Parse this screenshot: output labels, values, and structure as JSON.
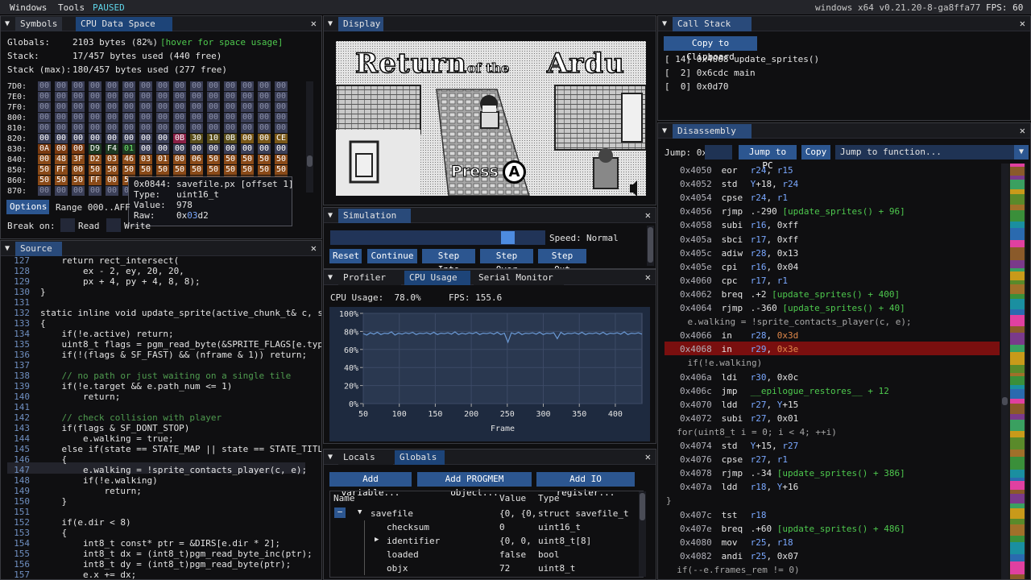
{
  "menubar": {
    "windows": "Windows",
    "tools": "Tools",
    "status": "PAUSED",
    "version": "windows x64 v0.21.20-8-ga8ffa77",
    "fps": "FPS: 60"
  },
  "symbols": {
    "tab1": "Symbols",
    "tab2": "CPU Data Space",
    "globals_label": "Globals:",
    "globals_value": "2103 bytes (82%)",
    "globals_hint": "[hover for space usage]",
    "stack_label": "Stack:",
    "stack_value": "17/457 bytes used (440 free)",
    "stackmax_label": "Stack (max):",
    "stackmax_value": "180/457 bytes used (277 free)",
    "hex_rows": [
      "7D0:",
      "7E0:",
      "7F0:",
      "800:",
      "810:",
      "820:",
      "830:",
      "840:",
      "850:",
      "860:",
      "870:"
    ],
    "row820": [
      "00",
      "00",
      "00",
      "00",
      "00",
      "00",
      "00",
      "00",
      "0B",
      "30",
      "10",
      "0B",
      "00",
      "00",
      "CE"
    ],
    "row830": [
      "0A",
      "00",
      "00",
      "D9",
      "F4",
      "01",
      "00",
      "00",
      "00",
      "00",
      "00",
      "00",
      "00",
      "00",
      "00"
    ],
    "row840": [
      "00",
      "48",
      "3F",
      "D2",
      "03",
      "46",
      "03",
      "01",
      "00",
      "06",
      "50",
      "50",
      "50",
      "50",
      "50"
    ],
    "row850": [
      "50",
      "FF",
      "00",
      "50",
      "50",
      "50",
      "50",
      "50",
      "50",
      "50",
      "50",
      "50",
      "50",
      "50",
      "50"
    ],
    "row860": [
      "50",
      "50",
      "50",
      "FF",
      "00",
      "50",
      "50",
      "50",
      "50",
      "50",
      "50",
      "50",
      "50",
      "50",
      "50"
    ],
    "tooltip": {
      "title": "0x0844: savefile.px [offset 1]",
      "type": "Type:   uint16_t",
      "value": "Value:  978",
      "raw_label": "Raw:    0x",
      "raw_a": "03",
      "raw_b": "d2"
    },
    "options": "Options",
    "range": "Range 000..AFF",
    "break_on": "Break on:",
    "read": "Read",
    "write": "Write"
  },
  "source": {
    "tab": "Source",
    "lines": [
      {
        "n": "127",
        "t": "    return rect_intersect("
      },
      {
        "n": "128",
        "t": "        ex - 2, ey, 20, 20,"
      },
      {
        "n": "129",
        "t": "        px + 4, py + 4, 8, 8);"
      },
      {
        "n": "130",
        "t": "}"
      },
      {
        "n": "131",
        "t": ""
      },
      {
        "n": "132",
        "t": "static inline void update_sprite(active_chunk_t& c, s"
      },
      {
        "n": "133",
        "t": "{"
      },
      {
        "n": "134",
        "t": "    if(!e.active) return;"
      },
      {
        "n": "135",
        "t": "    uint8_t flags = pgm_read_byte(&SPRITE_FLAGS[e.typ"
      },
      {
        "n": "136",
        "t": "    if(!(flags & SF_FAST) && (nframe & 1)) return;"
      },
      {
        "n": "137",
        "t": ""
      },
      {
        "n": "138",
        "t": "    // no path or just waiting on a single tile"
      },
      {
        "n": "139",
        "t": "    if(!e.target && e.path_num <= 1)"
      },
      {
        "n": "140",
        "t": "        return;"
      },
      {
        "n": "141",
        "t": ""
      },
      {
        "n": "142",
        "t": "    // check collision with player"
      },
      {
        "n": "143",
        "t": "    if(flags & SF_DONT_STOP)"
      },
      {
        "n": "144",
        "t": "        e.walking = true;"
      },
      {
        "n": "145",
        "t": "    else if(state == STATE_MAP || state == STATE_TITL"
      },
      {
        "n": "146",
        "t": "    {"
      },
      {
        "n": "147",
        "t": "        e.walking = !sprite_contacts_player(c, e);"
      },
      {
        "n": "148",
        "t": "        if(!e.walking)"
      },
      {
        "n": "149",
        "t": "            return;"
      },
      {
        "n": "150",
        "t": "    }"
      },
      {
        "n": "151",
        "t": ""
      },
      {
        "n": "152",
        "t": "    if(e.dir < 8)"
      },
      {
        "n": "153",
        "t": "    {"
      },
      {
        "n": "154",
        "t": "        int8_t const* ptr = &DIRS[e.dir * 2];"
      },
      {
        "n": "155",
        "t": "        int8_t dx = (int8_t)pgm_read_byte_inc(ptr);"
      },
      {
        "n": "156",
        "t": "        int8_t dy = (int8_t)pgm_read_byte(ptr);"
      },
      {
        "n": "157",
        "t": "        e.x += dx;"
      }
    ]
  },
  "display": {
    "tab": "Display",
    "title_a": "Return",
    "title_b": "of the",
    "title_c": "Ardu",
    "press": "Press",
    "btn_a": "A"
  },
  "simulation": {
    "tab": "Simulation",
    "speed_label": "Speed:",
    "speed_value": "Normal",
    "reset": "Reset",
    "continue": "Continue",
    "step_into": "Step Into",
    "step_over": "Step Over",
    "step_out": "Step Out"
  },
  "profiler": {
    "tab1": "Profiler",
    "tab2": "CPU Usage",
    "tab3": "Serial Monitor",
    "cpu_usage": "CPU Usage:  78.0%",
    "fps": "FPS: 155.6",
    "xlabel": "Frame"
  },
  "chart_data": {
    "type": "line",
    "xlabel": "Frame",
    "ylabel": "",
    "yticks": [
      "100%",
      "80%",
      "60%",
      "40%",
      "20%",
      "0%"
    ],
    "xticks": [
      "50",
      "100",
      "150",
      "200",
      "250",
      "300",
      "350",
      "400"
    ],
    "xlim": [
      50,
      437
    ],
    "ylim": [
      0,
      100
    ],
    "series": [
      {
        "values": [
          77.5,
          76.0,
          78.5,
          77.0,
          79.0,
          76.5,
          78.0,
          77.5,
          79.5,
          76.0,
          78.0,
          77.0,
          78.5,
          77.5,
          79.0,
          76.5,
          78.0,
          77.5,
          78.5,
          77.0,
          79.0,
          76.5,
          78.0,
          77.5,
          78.5,
          77.0,
          79.5,
          76.5,
          78.0,
          77.0,
          78.5,
          77.5,
          79.0,
          76.5,
          78.0,
          77.5,
          78.5,
          77.0,
          79.0,
          76.5,
          78.0,
          68.0,
          78.5,
          77.0,
          79.0,
          76.5,
          78.0,
          77.5,
          78.5,
          77.0,
          79.0,
          76.5,
          78.0,
          77.5,
          78.5,
          72.0,
          79.0,
          76.5,
          78.0,
          77.5,
          78.5,
          77.0,
          79.0,
          76.5,
          78.0,
          77.5,
          78.5,
          77.0,
          79.0,
          76.5,
          78.0,
          77.5,
          78.5,
          77.0,
          79.5,
          76.5,
          78.0,
          77.5,
          78.5,
          77.0
        ]
      }
    ]
  },
  "locals": {
    "tab1": "Locals",
    "tab2": "Globals",
    "add_var": "Add variable...",
    "add_progmem": "Add PROGMEM object...",
    "add_io": "Add IO register...",
    "col_name": "Name",
    "col_value": "Value",
    "col_type": "Type",
    "rows": [
      {
        "name": "savefile",
        "value": "{0, {0,",
        "type": "struct savefile_t"
      },
      {
        "name": "checksum",
        "value": "0",
        "type": "uint16_t"
      },
      {
        "name": "identifier",
        "value": "{0, 0,",
        "type": "uint8_t[8]"
      },
      {
        "name": "loaded",
        "value": "false",
        "type": "bool"
      },
      {
        "name": "objx",
        "value": "72",
        "type": "uint8_t"
      }
    ]
  },
  "callstack": {
    "tab": "Call Stack",
    "copy": "Copy to Clipboard",
    "frames": [
      {
        "idx": "[ 14]",
        "addr": "0x4068",
        "fn": "update_sprites()"
      },
      {
        "idx": "[  2]",
        "addr": "0x6cdc",
        "fn": "main"
      },
      {
        "idx": "[  0]",
        "addr": "0x0d70",
        "fn": ""
      }
    ]
  },
  "disasm": {
    "tab": "Disassembly",
    "jump_label": "Jump: 0x",
    "jump_pc": "Jump to PC",
    "copy": "Copy",
    "jump_fn": "Jump to function...",
    "lines": [
      {
        "k": "i",
        "a": "0x4050",
        "m": "eor",
        "o": [
          [
            "r24",
            "reg"
          ],
          [
            ", ",
            ""
          ],
          [
            "r15",
            "reg"
          ]
        ]
      },
      {
        "k": "i",
        "a": "0x4052",
        "m": "std",
        "o": [
          [
            "Y",
            "reg"
          ],
          [
            "+18, ",
            ""
          ],
          [
            "r24",
            "reg"
          ]
        ]
      },
      {
        "k": "i",
        "a": "0x4054",
        "m": "cpse",
        "o": [
          [
            "r24",
            "reg"
          ],
          [
            ", ",
            ""
          ],
          [
            "r1",
            "reg"
          ]
        ]
      },
      {
        "k": "i",
        "a": "0x4056",
        "m": "rjmp",
        "o": [
          [
            ".-290 ",
            ""
          ],
          [
            "[update_sprites() + 96]",
            "grn"
          ]
        ]
      },
      {
        "k": "i",
        "a": "0x4058",
        "m": "subi",
        "o": [
          [
            "r16",
            "reg"
          ],
          [
            ", 0xff",
            ""
          ]
        ]
      },
      {
        "k": "i",
        "a": "0x405a",
        "m": "sbci",
        "o": [
          [
            "r17",
            "reg"
          ],
          [
            ", 0xff",
            ""
          ]
        ]
      },
      {
        "k": "i",
        "a": "0x405c",
        "m": "adiw",
        "o": [
          [
            "r28",
            "reg"
          ],
          [
            ", 0x13",
            ""
          ]
        ]
      },
      {
        "k": "i",
        "a": "0x405e",
        "m": "cpi",
        "o": [
          [
            "r16",
            "reg"
          ],
          [
            ", 0x04",
            ""
          ]
        ]
      },
      {
        "k": "i",
        "a": "0x4060",
        "m": "cpc",
        "o": [
          [
            "r17",
            "reg"
          ],
          [
            ", ",
            ""
          ],
          [
            "r1",
            "reg"
          ]
        ]
      },
      {
        "k": "i",
        "a": "0x4062",
        "m": "breq",
        "o": [
          [
            ".+2 ",
            ""
          ],
          [
            "[update_sprites() + 400]",
            "grn"
          ]
        ]
      },
      {
        "k": "i",
        "a": "0x4064",
        "m": "rjmp",
        "o": [
          [
            ".-360 ",
            ""
          ],
          [
            "[update_sprites() + 40]",
            "grn"
          ]
        ]
      },
      {
        "k": "s",
        "t": "    e.walking = !sprite_contacts_player(c, e);"
      },
      {
        "k": "i",
        "a": "0x4066",
        "m": "in",
        "o": [
          [
            "r28",
            "reg"
          ],
          [
            ", ",
            ""
          ],
          [
            "0x3d",
            "num"
          ]
        ]
      },
      {
        "k": "h",
        "a": "0x4068",
        "m": "in",
        "o": [
          [
            "r29",
            "reg"
          ],
          [
            ", ",
            ""
          ],
          [
            "0x3e",
            "num"
          ]
        ]
      },
      {
        "k": "s",
        "t": "    if(!e.walking)"
      },
      {
        "k": "i",
        "a": "0x406a",
        "m": "ldi",
        "o": [
          [
            "r30",
            "reg"
          ],
          [
            ", 0x0c",
            ""
          ]
        ]
      },
      {
        "k": "i",
        "a": "0x406c",
        "m": "jmp",
        "o": [
          [
            "__epilogue_restores__ + 12",
            "grn"
          ]
        ]
      },
      {
        "k": "i",
        "a": "0x4070",
        "m": "ldd",
        "o": [
          [
            "r27",
            "reg"
          ],
          [
            ", ",
            ""
          ],
          [
            "Y",
            "reg"
          ],
          [
            "+15",
            ""
          ]
        ]
      },
      {
        "k": "i",
        "a": "0x4072",
        "m": "subi",
        "o": [
          [
            "r27",
            "reg"
          ],
          [
            ", 0x01",
            ""
          ]
        ]
      },
      {
        "k": "s",
        "t": "  for(uint8_t i = 0; i < 4; ++i)"
      },
      {
        "k": "i",
        "a": "0x4074",
        "m": "std",
        "o": [
          [
            "Y",
            "reg"
          ],
          [
            "+15, ",
            ""
          ],
          [
            "r27",
            "reg"
          ]
        ]
      },
      {
        "k": "i",
        "a": "0x4076",
        "m": "cpse",
        "o": [
          [
            "r27",
            "reg"
          ],
          [
            ", ",
            ""
          ],
          [
            "r1",
            "reg"
          ]
        ]
      },
      {
        "k": "i",
        "a": "0x4078",
        "m": "rjmp",
        "o": [
          [
            ".-34 ",
            ""
          ],
          [
            "[update_sprites() + 386]",
            "grn"
          ]
        ]
      },
      {
        "k": "i",
        "a": "0x407a",
        "m": "ldd",
        "o": [
          [
            "r18",
            "reg"
          ],
          [
            ", ",
            ""
          ],
          [
            "Y",
            "reg"
          ],
          [
            "+16",
            ""
          ]
        ]
      },
      {
        "k": "s",
        "t": "}"
      },
      {
        "k": "i",
        "a": "0x407c",
        "m": "tst",
        "o": [
          [
            "r18",
            "reg"
          ]
        ]
      },
      {
        "k": "i",
        "a": "0x407e",
        "m": "breq",
        "o": [
          [
            ".+60 ",
            ""
          ],
          [
            "[update_sprites() + 486]",
            "grn"
          ]
        ]
      },
      {
        "k": "i",
        "a": "0x4080",
        "m": "mov",
        "o": [
          [
            "r25",
            "reg"
          ],
          [
            ", ",
            ""
          ],
          [
            "r18",
            "reg"
          ]
        ]
      },
      {
        "k": "i",
        "a": "0x4082",
        "m": "andi",
        "o": [
          [
            "r25",
            "reg"
          ],
          [
            ", 0x07",
            ""
          ]
        ]
      },
      {
        "k": "s",
        "t": "  if(--e.frames_rem != 0)"
      }
    ]
  },
  "colors": {
    "accent": "#2c5690",
    "tab_active": "#294a7a",
    "highlight": "#7a0f0f",
    "green": "#4ec94e",
    "orange": "#e0884a",
    "reg": "#7aa8ff",
    "plot_line": "#6b9ad6"
  }
}
